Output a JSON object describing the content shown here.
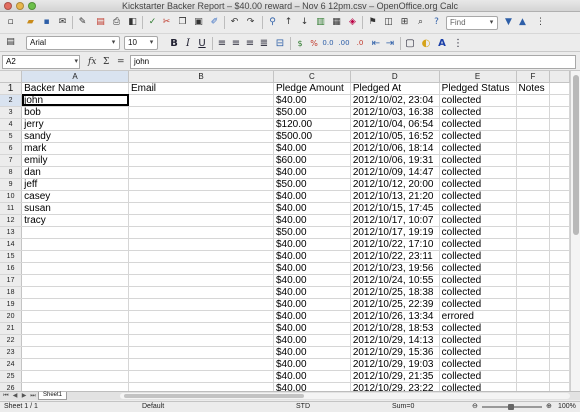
{
  "window": {
    "title": "Kickstarter Backer Report – $40.00 reward – Nov 6 12pm.csv – OpenOffice.org Calc"
  },
  "toolbar": {
    "find_placeholder": "Find",
    "icons": [
      "new-icon",
      "open-icon",
      "save-icon",
      "email-icon",
      "edit-file-icon",
      "export-pdf-icon",
      "print-icon",
      "page-preview-icon",
      "spellcheck-icon",
      "autospell-icon",
      "cut-icon",
      "copy-icon",
      "paste-icon",
      "clone-format-icon",
      "undo-icon",
      "redo-icon",
      "hyperlink-icon",
      "sort-asc-icon",
      "sort-desc-icon",
      "chart-icon",
      "pivot-icon",
      "draw-icon",
      "navigator-icon",
      "gallery-icon",
      "datasources-icon",
      "zoom-icon",
      "help-icon"
    ]
  },
  "format": {
    "style": "",
    "font": "Arial",
    "size": "10",
    "bold": "B",
    "italic": "I",
    "underline": "U"
  },
  "formula_bar": {
    "cell_ref": "A2",
    "content": "john"
  },
  "grid": {
    "columns": [
      "A",
      "B",
      "C",
      "D",
      "E",
      "F"
    ],
    "headers": [
      "Backer Name",
      "Email",
      "Pledge Amount",
      "Pledged At",
      "Pledged Status",
      "Notes"
    ],
    "rows": [
      [
        "john",
        "",
        "$40.00",
        "2012/10/02, 23:04",
        "collected",
        ""
      ],
      [
        "bob",
        "",
        "$50.00",
        "2012/10/03, 16:38",
        "collected",
        ""
      ],
      [
        "jerry",
        "",
        "$120.00",
        "2012/10/04, 06:54",
        "collected",
        ""
      ],
      [
        "sandy",
        "",
        "$500.00",
        "2012/10/05, 16:52",
        "collected",
        ""
      ],
      [
        "mark",
        "",
        "$40.00",
        "2012/10/06, 18:14",
        "collected",
        ""
      ],
      [
        "emily",
        "",
        "$60.00",
        "2012/10/06, 19:31",
        "collected",
        ""
      ],
      [
        "dan",
        "",
        "$40.00",
        "2012/10/09, 14:47",
        "collected",
        ""
      ],
      [
        "jeff",
        "",
        "$50.00",
        "2012/10/12, 20:00",
        "collected",
        ""
      ],
      [
        "casey",
        "",
        "$40.00",
        "2012/10/13, 21:20",
        "collected",
        ""
      ],
      [
        "susan",
        "",
        "$40.00",
        "2012/10/15, 17:45",
        "collected",
        ""
      ],
      [
        "tracy",
        "",
        "$40.00",
        "2012/10/17, 10:07",
        "collected",
        ""
      ],
      [
        "",
        "",
        "$50.00",
        "2012/10/17, 19:19",
        "collected",
        ""
      ],
      [
        "",
        "",
        "$40.00",
        "2012/10/22, 17:10",
        "collected",
        ""
      ],
      [
        "",
        "",
        "$40.00",
        "2012/10/22, 23:11",
        "collected",
        ""
      ],
      [
        "",
        "",
        "$40.00",
        "2012/10/23, 19:56",
        "collected",
        ""
      ],
      [
        "",
        "",
        "$40.00",
        "2012/10/24, 10:55",
        "collected",
        ""
      ],
      [
        "",
        "",
        "$40.00",
        "2012/10/25, 18:38",
        "collected",
        ""
      ],
      [
        "",
        "",
        "$40.00",
        "2012/10/25, 22:39",
        "collected",
        ""
      ],
      [
        "",
        "",
        "$40.00",
        "2012/10/26, 13:34",
        "errored",
        ""
      ],
      [
        "",
        "",
        "$40.00",
        "2012/10/28, 18:53",
        "collected",
        ""
      ],
      [
        "",
        "",
        "$40.00",
        "2012/10/29, 14:13",
        "collected",
        ""
      ],
      [
        "",
        "",
        "$40.00",
        "2012/10/29, 15:36",
        "collected",
        ""
      ],
      [
        "",
        "",
        "$40.00",
        "2012/10/29, 19:03",
        "collected",
        ""
      ],
      [
        "",
        "",
        "$40.00",
        "2012/10/29, 21:35",
        "collected",
        ""
      ],
      [
        "",
        "",
        "$40.00",
        "2012/10/29, 23:22",
        "collected",
        ""
      ]
    ]
  },
  "sheet_tabs": [
    "Sheet1"
  ],
  "status": {
    "sheet": "Sheet 1 / 1",
    "page_style": "Default",
    "mode": "STD",
    "sum": "Sum=0",
    "zoom": "100%"
  },
  "colors": {
    "selection_header": "#d9e3f0",
    "grid_line": "#d6d6d6",
    "chrome": "#ececec"
  }
}
